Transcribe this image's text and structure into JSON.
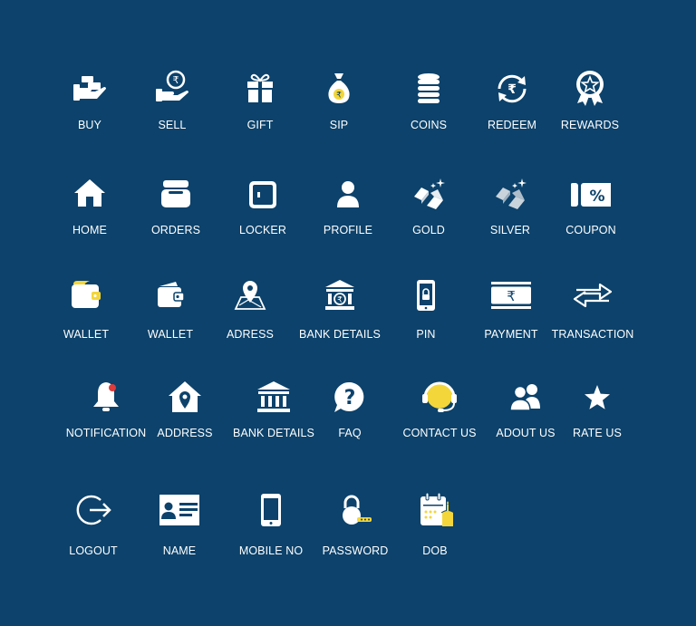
{
  "colors": {
    "background": "#0c426b",
    "icon": "#ffffff",
    "accent": "#f3d63a",
    "alert": "#e03a3a"
  },
  "icons": [
    {
      "id": "buy",
      "label": "BUY",
      "icon": "gold-bars-hand-icon"
    },
    {
      "id": "sell",
      "label": "SELL",
      "icon": "rupee-coin-hand-icon"
    },
    {
      "id": "gift",
      "label": "GIFT",
      "icon": "gift-icon"
    },
    {
      "id": "sip",
      "label": "SIP",
      "icon": "money-bag-icon"
    },
    {
      "id": "coins",
      "label": "COINS",
      "icon": "coin-stack-icon"
    },
    {
      "id": "redeem",
      "label": "REDEEM",
      "icon": "rupee-refresh-icon"
    },
    {
      "id": "rewards",
      "label": "REWARDS",
      "icon": "award-medal-icon"
    },
    {
      "id": "home",
      "label": "HOME",
      "icon": "home-icon"
    },
    {
      "id": "orders",
      "label": "ORDERS",
      "icon": "orders-box-icon"
    },
    {
      "id": "locker",
      "label": "LOCKER",
      "icon": "locker-icon"
    },
    {
      "id": "profile",
      "label": "PROFILE",
      "icon": "user-icon"
    },
    {
      "id": "gold",
      "label": "GOLD",
      "icon": "gold-bars-sparkle-icon"
    },
    {
      "id": "silver",
      "label": "SILVER",
      "icon": "silver-bars-sparkle-icon"
    },
    {
      "id": "coupon",
      "label": "COUPON",
      "icon": "coupon-percent-icon"
    },
    {
      "id": "wallet1",
      "label": "WALLET",
      "icon": "wallet-icon"
    },
    {
      "id": "wallet2",
      "label": "WALLET",
      "icon": "wallet-open-icon"
    },
    {
      "id": "adress",
      "label": "ADRESS",
      "icon": "map-pin-icon"
    },
    {
      "id": "bank1",
      "label": "BANK DETAILS",
      "icon": "bank-rupee-icon"
    },
    {
      "id": "pin",
      "label": "PIN",
      "icon": "phone-lock-icon"
    },
    {
      "id": "payment",
      "label": "PAYMENT",
      "icon": "rupee-banknote-icon"
    },
    {
      "id": "transaction",
      "label": "TRANSACTION",
      "icon": "transfer-arrows-icon"
    },
    {
      "id": "notification",
      "label": "NOTIFICATION",
      "icon": "bell-icon"
    },
    {
      "id": "address",
      "label": "ADDRESS",
      "icon": "home-location-icon"
    },
    {
      "id": "bank2",
      "label": "BANK DETAILS",
      "icon": "bank-icon"
    },
    {
      "id": "faq",
      "label": "FAQ",
      "icon": "question-bubble-icon"
    },
    {
      "id": "contact",
      "label": "CONTACT US",
      "icon": "headset-icon"
    },
    {
      "id": "about",
      "label": "ADOUT US",
      "icon": "users-group-icon"
    },
    {
      "id": "rate",
      "label": "RATE US",
      "icon": "star-icon"
    },
    {
      "id": "logout",
      "label": "LOGOUT",
      "icon": "logout-icon"
    },
    {
      "id": "name",
      "label": "NAME",
      "icon": "id-card-icon"
    },
    {
      "id": "mobile",
      "label": "MOBILE NO",
      "icon": "mobile-phone-icon"
    },
    {
      "id": "password",
      "label": "PASSWORD",
      "icon": "padlock-key-icon"
    },
    {
      "id": "dob",
      "label": "DOB",
      "icon": "calendar-cake-icon"
    }
  ]
}
